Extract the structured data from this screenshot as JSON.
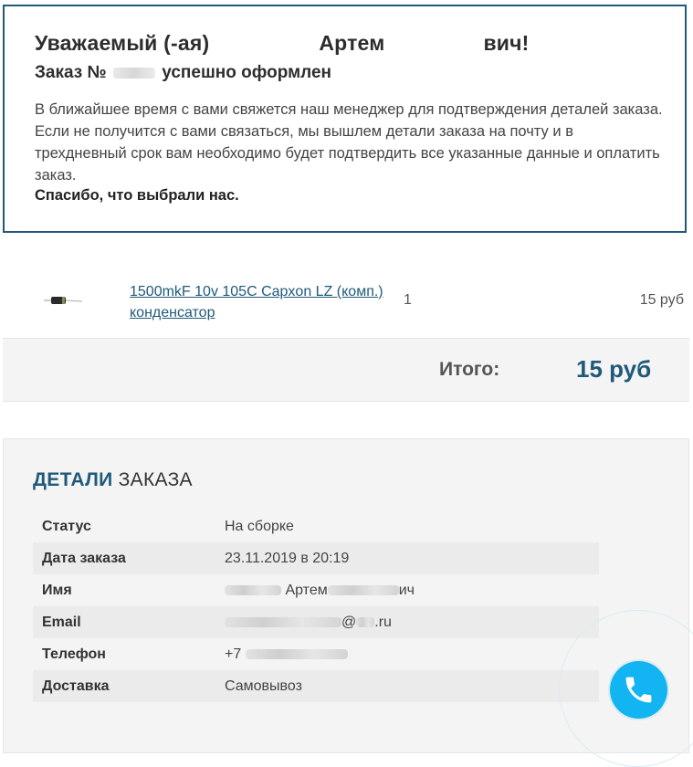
{
  "confirmation": {
    "greeting_prefix": "Уважаемый (-ая)",
    "greeting_name": "Артем",
    "greeting_suffix": "вич!",
    "order_prefix": "Заказ №",
    "order_suffix": "успешно оформлен",
    "description": "В ближайшее время с вами свяжется наш менеджер для подтверждения деталей заказа. Если не получится с вами связаться, мы вышлем детали заказа на почту и в трехдневный срок вам необходимо будет подтвердить все указанные данные и оплатить заказ.",
    "thanks": "Спасибо, что выбрали нас."
  },
  "cart": {
    "items": [
      {
        "name": "1500mkF 10v 105C Capxon LZ (комп.) конденсатор",
        "quantity": "1",
        "price": "15 руб",
        "image_icon": "capacitor-image"
      }
    ],
    "total_label": "Итого:",
    "total_value": "15 руб"
  },
  "details": {
    "title_accent": "ДЕТАЛИ",
    "title_rest": "ЗАКАЗА",
    "rows": [
      {
        "label": "Статус",
        "value": "На сборке"
      },
      {
        "label": "Дата заказа",
        "value": "23.11.2019 в 20:19"
      },
      {
        "label": "Имя",
        "value": "Артем",
        "value_suffix": "ич"
      },
      {
        "label": "Email",
        "value": "@",
        "value_suffix": ".ru"
      },
      {
        "label": "Телефон",
        "value": "+7"
      },
      {
        "label": "Доставка",
        "value": "Самовывоз"
      }
    ]
  },
  "call_button": {
    "icon": "phone-icon",
    "color": "#13b4f2"
  },
  "colors": {
    "accent": "#1f5a7a",
    "border": "#1f5a7a",
    "panel": "#f4f4f4"
  }
}
